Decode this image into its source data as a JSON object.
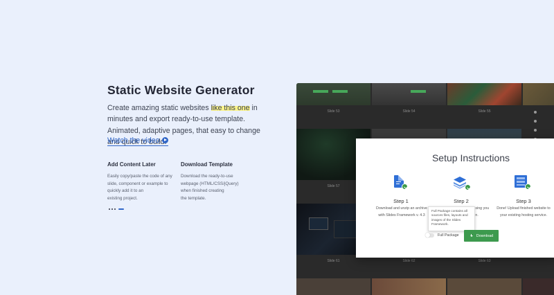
{
  "hero": {
    "title": "Static Website Generator",
    "desc_before": "Create amazing static websites ",
    "desc_highlight": "like this one",
    "desc_after": " in minutes and export ready-to-use template. Animated, adaptive pages, that easy to change and quick to build.",
    "watch_label": "Watch the video",
    "play_icon": "play-icon"
  },
  "features": [
    {
      "title": "Add Content Later",
      "lines": [
        "Easily copy/paste the code of any",
        "slide, component or example to",
        "quickly add it to an",
        "existing project."
      ]
    },
    {
      "title": "Download Template",
      "lines": [
        "Download the ready-to-use",
        "webpage (HTML/CSS/jQuery)",
        "when finished creating",
        "the template."
      ]
    }
  ],
  "pager": {
    "count": 4,
    "active_index": 3
  },
  "showcase": {
    "captions": [
      "Slide 53",
      "Slide 54",
      "Slide 55",
      "Slide 57",
      "Slide 61",
      "Slide 62",
      "Slide 63"
    ]
  },
  "modal": {
    "title": "Setup Instructions",
    "steps": [
      {
        "label": "Step 1",
        "lines": [
          "Download and unzip an archive",
          "with Slides Framework v. 4.3"
        ],
        "icon": "file-download-icon",
        "color": "#2f6fd6"
      },
      {
        "label": "Step 2",
        "lines": [
          "...sing you",
          "...n."
        ],
        "icon": "layers-icon",
        "color": "#2f6fd6"
      },
      {
        "label": "Step 3",
        "lines": [
          "Done! Upload finished website to",
          "your existing hosting service."
        ],
        "icon": "upload-icon",
        "color": "#2f6fd6"
      }
    ],
    "tooltip": "Full Package contains all sources files, layouts and images of the Slides Framework.",
    "toggle_label": "Full Package",
    "download_label": "Download"
  },
  "colors": {
    "accent": "#2f65c7",
    "success": "#3d9a4e",
    "highlight": "#fbf48a",
    "background": "#eaf0fc"
  }
}
